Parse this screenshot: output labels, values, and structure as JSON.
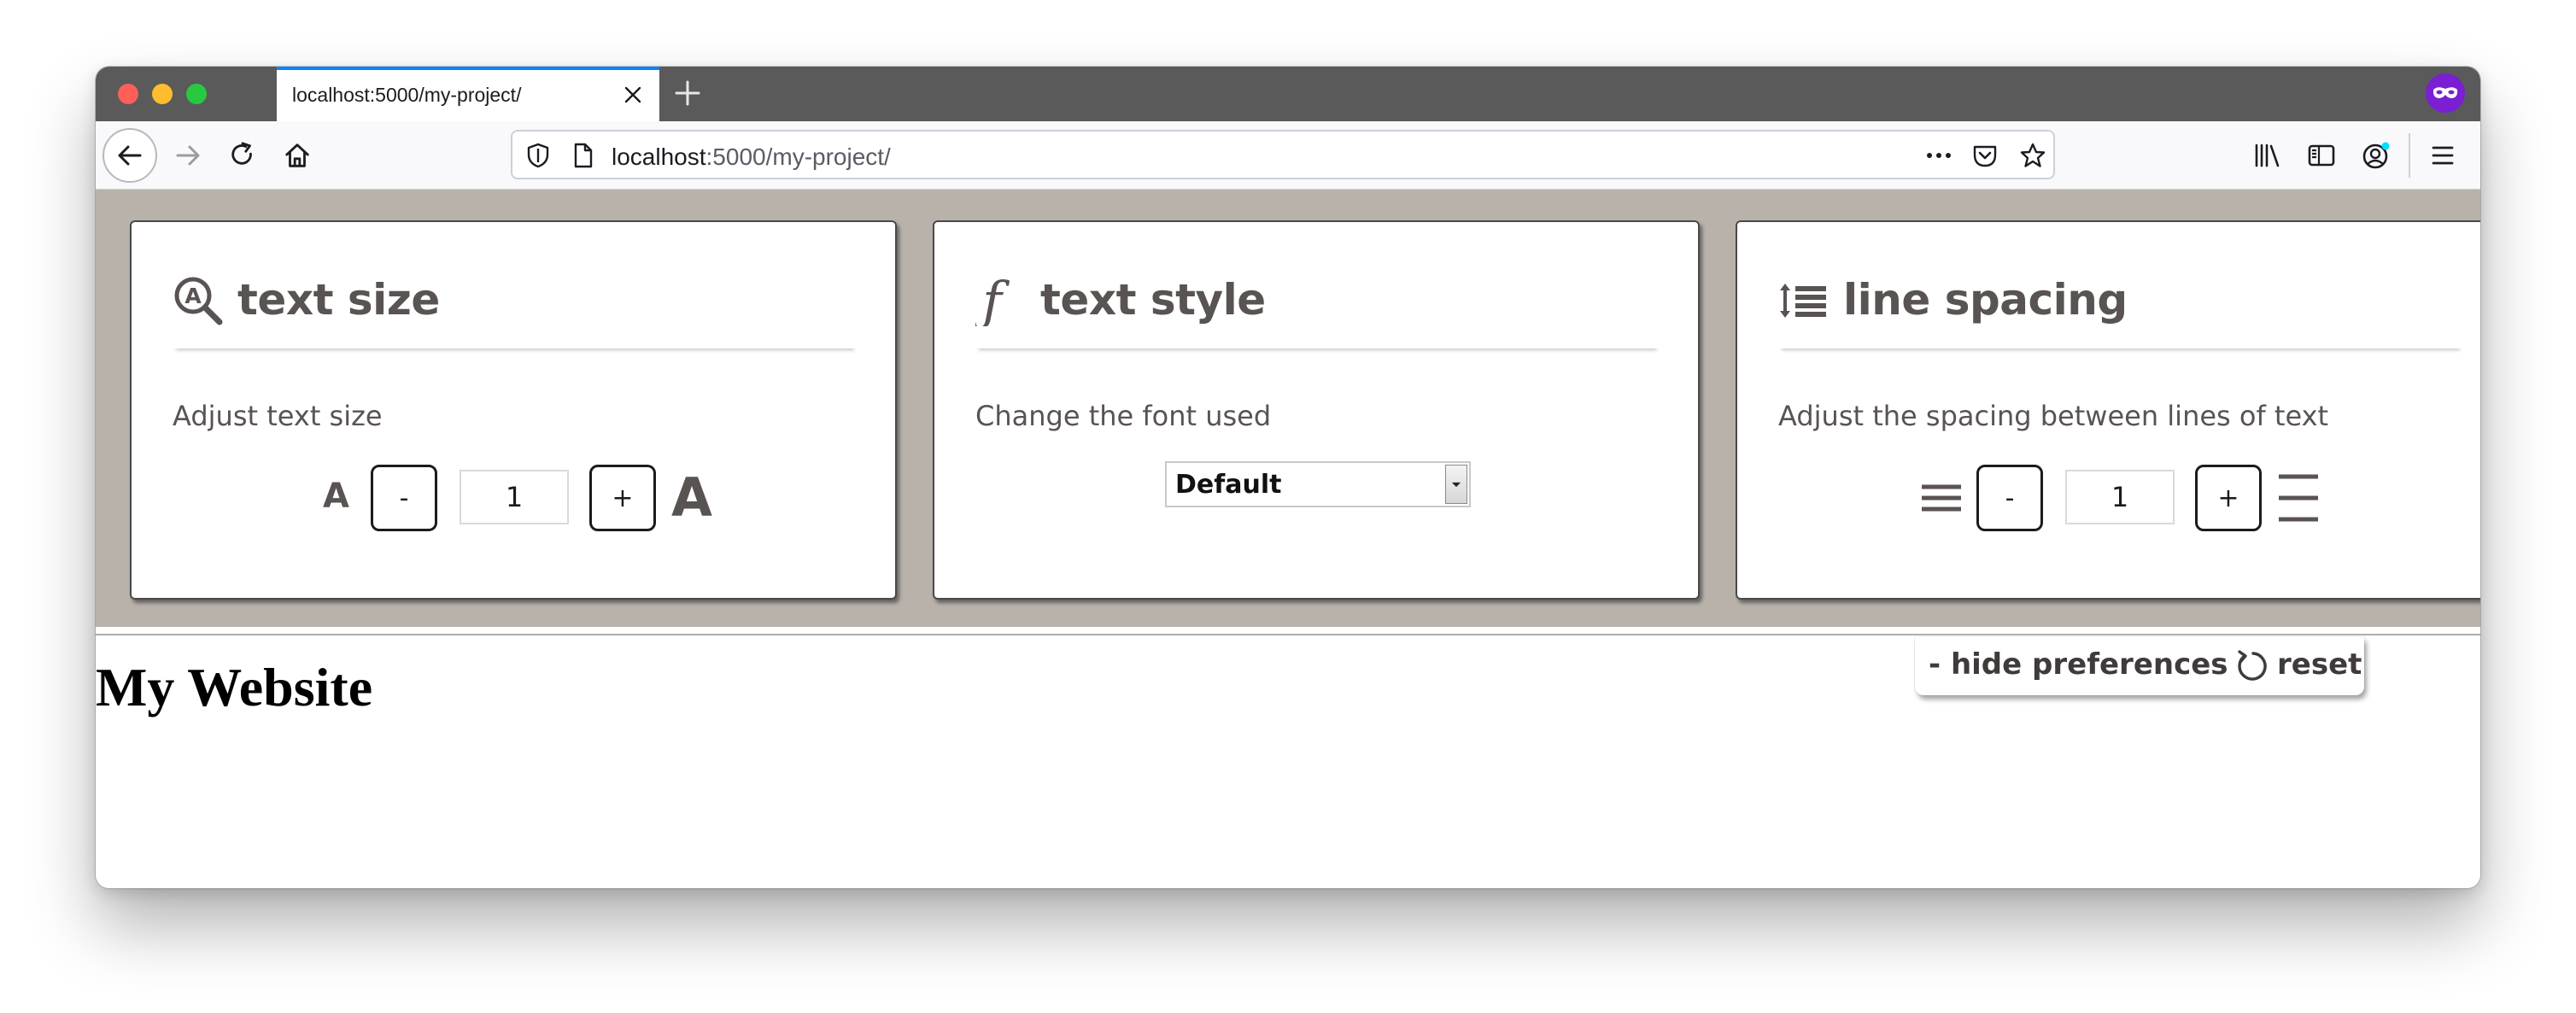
{
  "browser": {
    "tab_title": "localhost:5000/my-project/",
    "url_host": "localhost",
    "url_rest": ":5000/my-project/",
    "accent_color": "#0a84ff",
    "icons": [
      "back-icon",
      "forward-icon",
      "reload-icon",
      "home-icon",
      "tracking-shield-icon",
      "page-icon",
      "more-icon",
      "pocket-icon",
      "bookmark-star-icon",
      "library-icon",
      "sidebar-icon",
      "account-icon",
      "menu-icon",
      "private-mask-icon"
    ]
  },
  "preferences": {
    "background_color": "#b9b2ab",
    "text_size": {
      "title": "text size",
      "description": "Adjust text size",
      "small_glyph": "A",
      "large_glyph": "A",
      "decrease_label": "-",
      "increase_label": "+",
      "value": "1"
    },
    "text_style": {
      "title": "text style",
      "description": "Change the font used",
      "selected_font": "Default"
    },
    "line_spacing": {
      "title": "line spacing",
      "description": "Adjust the spacing between lines of text",
      "decrease_label": "-",
      "increase_label": "+",
      "value": "1"
    },
    "toggle": {
      "hide_label": "- hide preferences",
      "reset_label": "reset"
    }
  },
  "page": {
    "heading": "My Website"
  }
}
